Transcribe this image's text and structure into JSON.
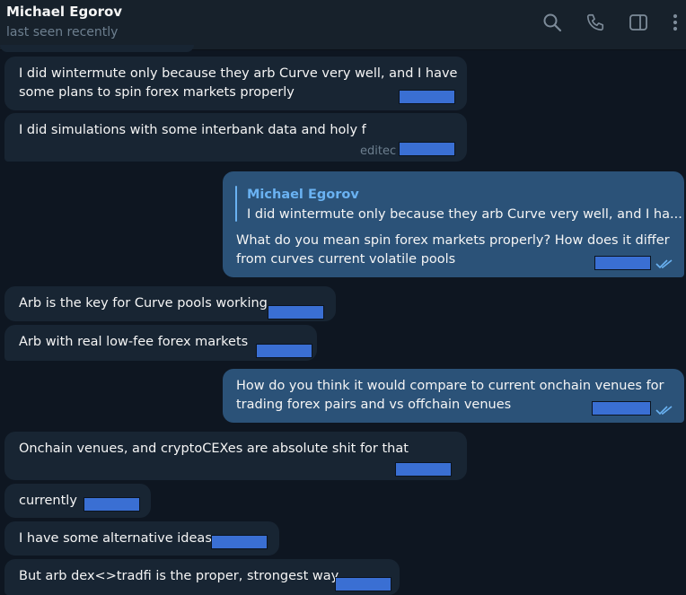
{
  "header": {
    "name": "Michael Egorov",
    "status": "last seen recently",
    "icons": [
      "search-icon",
      "phone-icon",
      "sidebar-icon",
      "more-icon"
    ]
  },
  "messages": [
    {
      "dir": "in",
      "lines": [
        "I did wintermute only because they arb Curve very well, and I have",
        "some plans to spin forex markets properly"
      ]
    },
    {
      "dir": "in",
      "lines": [
        "I did simulations with some interbank data and holy f"
      ],
      "edited": "editec"
    },
    {
      "dir": "out",
      "reply_name": "Michael Egorov",
      "reply_text": "I did wintermute only because they arb Curve very well, and I ha...",
      "lines": [
        "What do you mean spin forex markets properly? How does it differ",
        "from curves current volatile pools"
      ]
    },
    {
      "dir": "in",
      "lines": [
        "Arb is the key for Curve pools working"
      ]
    },
    {
      "dir": "in",
      "lines": [
        "Arb with real low-fee forex markets"
      ]
    },
    {
      "dir": "out",
      "lines": [
        "How do you think it would compare to current onchain venues for",
        "trading forex pairs and vs offchain venues"
      ]
    },
    {
      "dir": "in",
      "lines": [
        "Onchain venues, and cryptoCEXes are absolute shit for that"
      ]
    },
    {
      "dir": "in",
      "lines": [
        "currently"
      ]
    },
    {
      "dir": "in",
      "lines": [
        "I have some alternative ideas"
      ]
    },
    {
      "dir": "in",
      "lines": [
        "But arb dex<>tradfi is the proper, strongest way"
      ]
    }
  ],
  "colors": {
    "background": "#0e1621",
    "header": "#17212b",
    "incoming": "#182533",
    "outgoing": "#2b5278",
    "accent": "#6ab2f2",
    "redaction": "#3a6fd3"
  }
}
